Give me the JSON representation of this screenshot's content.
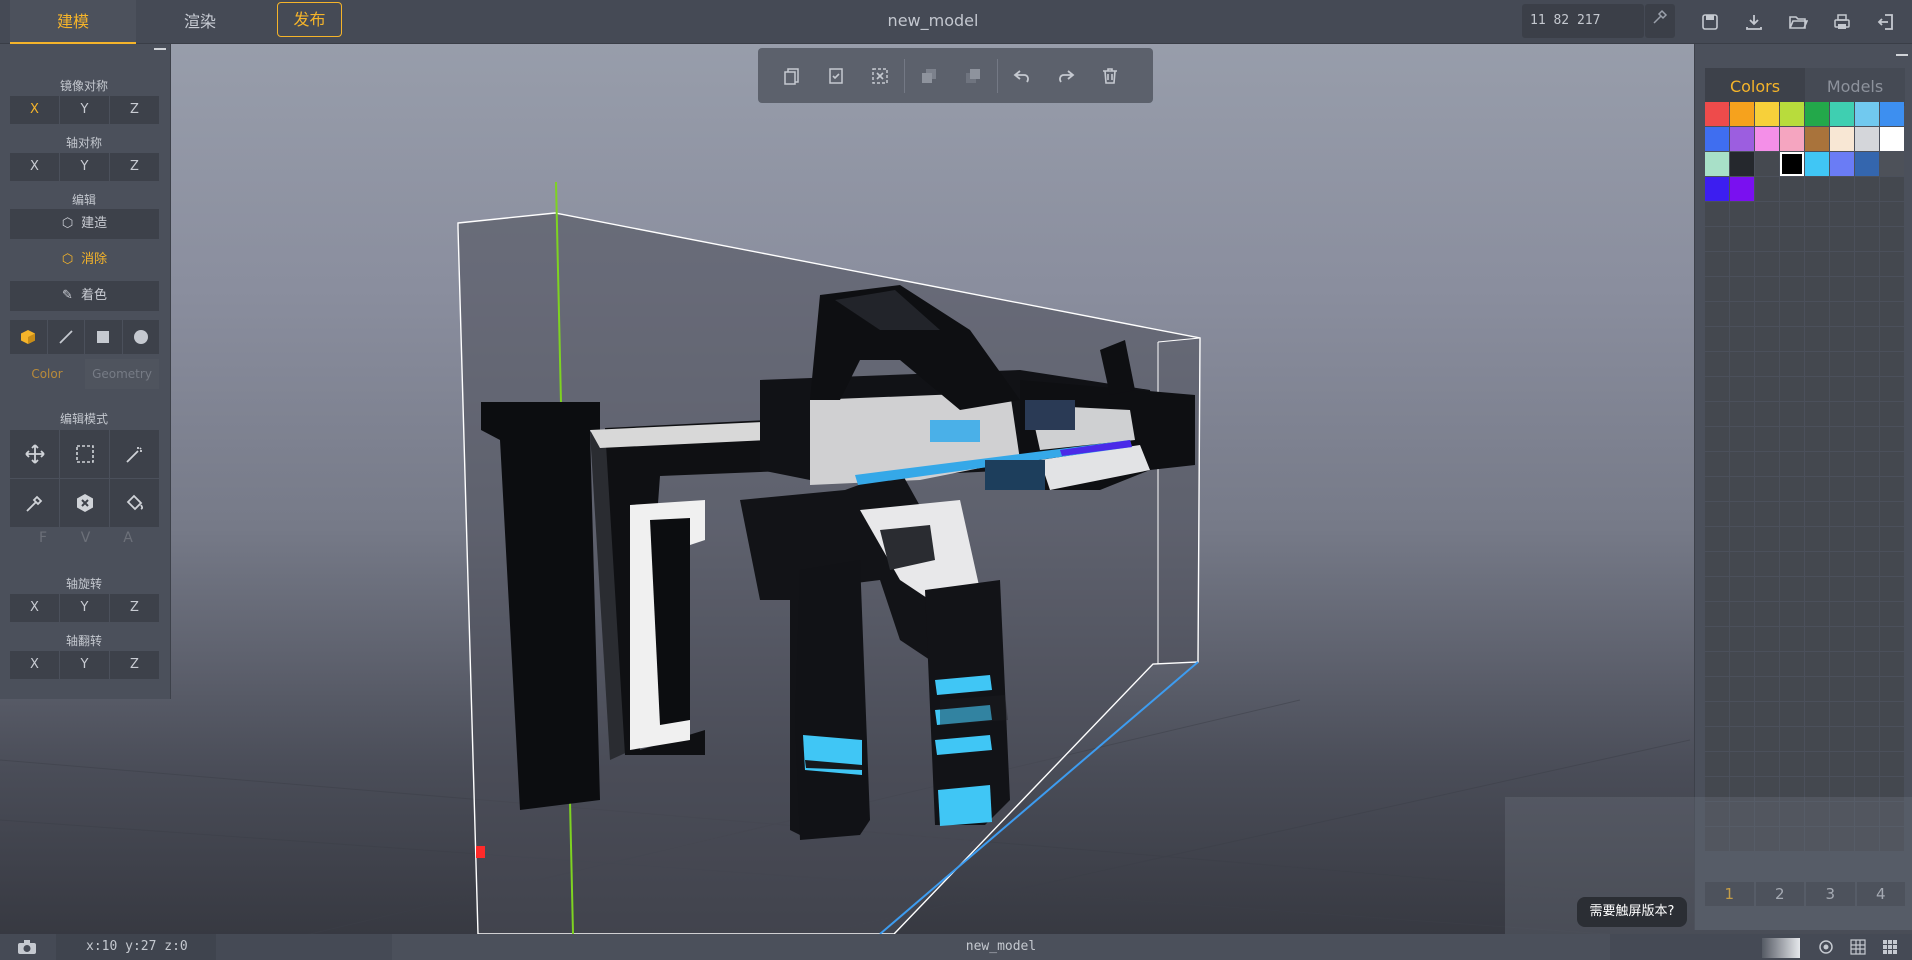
{
  "topbar": {
    "tabs": [
      "建模",
      "渲染"
    ],
    "publish_label": "发布",
    "title": "new_model",
    "coords": "11 82 217",
    "icons": [
      "save-icon",
      "download-icon",
      "folder-open-icon",
      "print-icon",
      "exit-icon"
    ]
  },
  "left_panel": {
    "mirror_label": "镜像对称",
    "mirror_axes": [
      "X",
      "Y",
      "Z"
    ],
    "axis_sym_label": "轴对称",
    "axis_sym_axes": [
      "X",
      "Y",
      "Z"
    ],
    "edit_label": "编辑",
    "build_label": "建造",
    "erase_label": "消除",
    "paint_label": "着色",
    "color_label": "Color",
    "geometry_label": "Geometry",
    "edit_mode_label": "编辑模式",
    "fva": [
      "F",
      "V",
      "A"
    ],
    "rotate_label": "轴旋转",
    "rotate_axes": [
      "X",
      "Y",
      "Z"
    ],
    "flip_label": "轴翻转",
    "flip_axes": [
      "X",
      "Y",
      "Z"
    ]
  },
  "right_panel": {
    "tabs": [
      "Colors",
      "Models"
    ],
    "swatches": [
      "#ee4b4b",
      "#f6a21d",
      "#f7d03a",
      "#b8dc3c",
      "#23a84a",
      "#3fcfb1",
      "#71c9ef",
      "#3d8ff0",
      "#3f6ef0",
      "#9c5ee0",
      "#f48fe8",
      "#f5a5c0",
      "#a9733b",
      "#f8e7d4",
      "#d4d6da",
      "#ffffff",
      "#a8e0c8",
      "#25282d",
      "#454950",
      "#000000",
      "#40c6f5",
      "#6a7cf5",
      "#3466ae",
      "#4d5159",
      "#3c1ef0",
      "#7a10f0"
    ],
    "selected_index": 19,
    "pages": [
      "1",
      "2",
      "3",
      "4"
    ]
  },
  "hint": "需要触屏版本?",
  "status": {
    "coords": "x:10 y:27 z:0",
    "model": "new_model"
  }
}
